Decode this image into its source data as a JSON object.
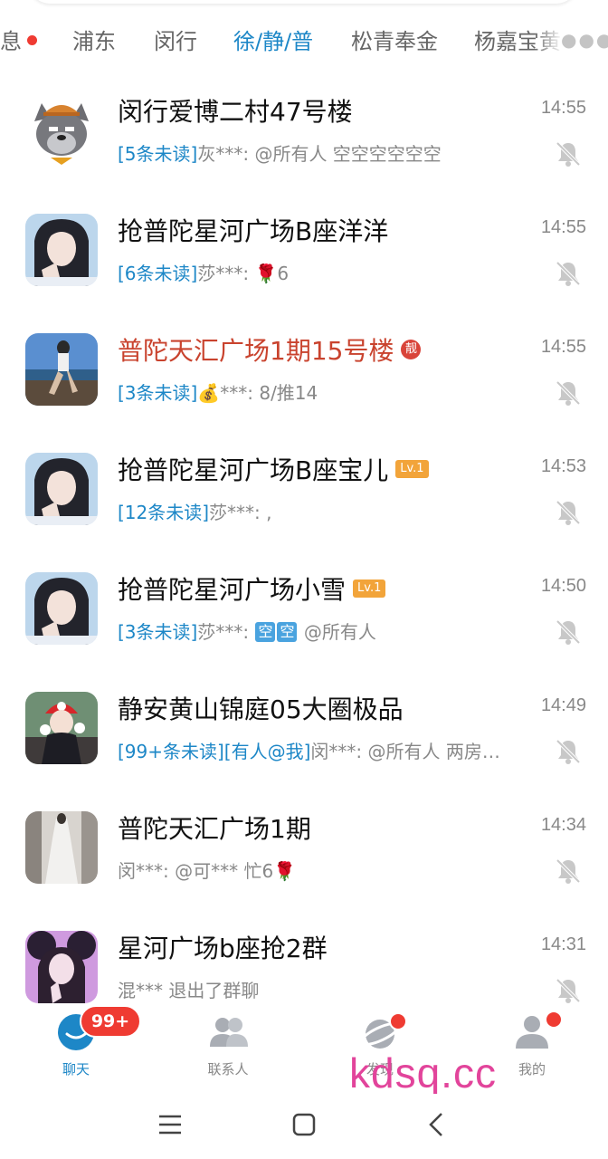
{
  "tabs": [
    {
      "label": "息",
      "dot": true
    },
    {
      "label": "浦东"
    },
    {
      "label": "闵行"
    },
    {
      "label": "徐/静/普",
      "active": true
    },
    {
      "label": "松青奉金"
    },
    {
      "label": "杨嘉宝黄"
    }
  ],
  "tab_more_icon": "more-dots-icon",
  "chats": [
    {
      "title": "闵行爱博二村47号楼",
      "unread": "[5条未读]",
      "sender": "灰***: ",
      "message": "@所有人 空空空空空空",
      "time": "14:55",
      "avatar": "wolf-cartoon"
    },
    {
      "title": "抢普陀星河广场B座洋洋",
      "unread": "[6条未读]",
      "sender": "莎***: ",
      "message": "🌹6",
      "time": "14:55",
      "avatar": "girl-portrait"
    },
    {
      "title": "普陀天汇广场1期15号楼",
      "title_color": "#c9432e",
      "badge": "靓",
      "unread": "[3条未读]",
      "sender": "💰***: ",
      "message": "8/推14",
      "time": "14:55",
      "avatar": "seaside-photo"
    },
    {
      "title": "抢普陀星河广场B座宝儿",
      "badge": "Lv.1",
      "unread": "[12条未读]",
      "sender": "莎***: ",
      "message": ",",
      "time": "14:53",
      "avatar": "girl-portrait"
    },
    {
      "title": "抢普陀星河广场小雪",
      "badge": "Lv.1",
      "unread": "[3条未读]",
      "sender": "莎***: ",
      "message_tags": [
        "空",
        "空"
      ],
      "message": "@所有人",
      "time": "14:50",
      "avatar": "girl-portrait"
    },
    {
      "title": "静安黄山锦庭05大圈极品",
      "unread": "[99+条未读][有人@我]",
      "sender": "闵***: ",
      "message": "@所有人 两房…",
      "time": "14:49",
      "avatar": "mario-hat-photo"
    },
    {
      "title": "普陀天汇广场1期",
      "unread": "",
      "sender": "闵***: ",
      "message": "@可*** 忙6🌹",
      "time": "14:34",
      "avatar": "dress-photo"
    },
    {
      "title": "星河广场b座抢2群",
      "unread": "",
      "sender": "混*** ",
      "message": "退出了群聊",
      "time": "14:31",
      "avatar": "purple-portrait"
    }
  ],
  "bottom_nav": [
    {
      "label": "聊天",
      "icon": "chat-bubble-icon",
      "badge": "99+",
      "active": true
    },
    {
      "label": "联系人",
      "icon": "contacts-icon"
    },
    {
      "label": "发现",
      "icon": "planet-icon",
      "dot": true
    },
    {
      "label": "我的",
      "icon": "profile-icon",
      "dot": true
    }
  ],
  "watermark": "kdsq.cc",
  "colors": {
    "accent": "#1d87c7",
    "red": "#ef3b32",
    "title_red": "#c9432e",
    "lv_badge": "#f2a43a"
  }
}
